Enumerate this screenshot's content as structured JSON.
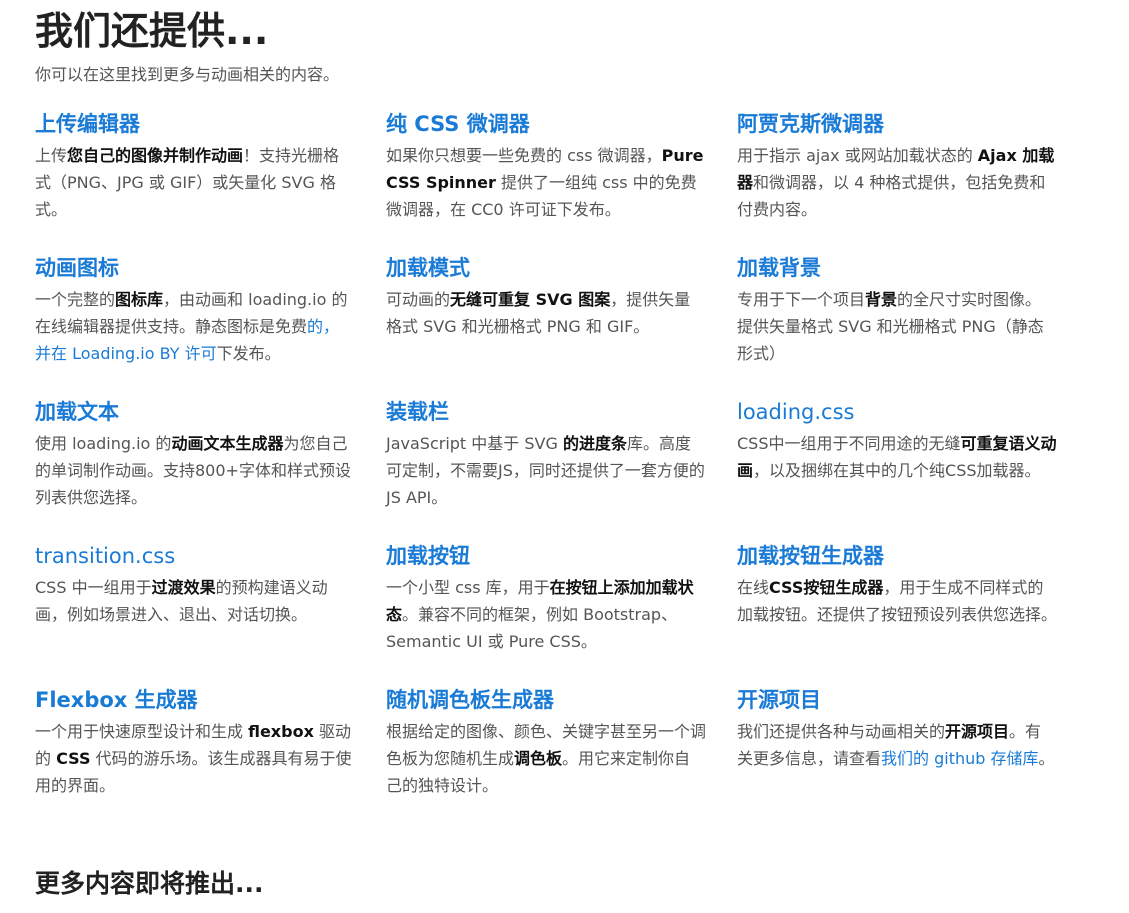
{
  "page": {
    "title": "我们还提供...",
    "subtitle": "你可以在这里找到更多与动画相关的内容。",
    "footer_heading": "更多内容即将推出..."
  },
  "colors": {
    "link": "#1a7bd6",
    "heading": "#222222",
    "text": "#555555",
    "emphasis": "#111111"
  },
  "cards": [
    {
      "title": "上传编辑器",
      "t0": "上传",
      "b0": "您自己的图像并制作动画",
      "t1": "！支持光栅格式（PNG、JPG 或 GIF）或矢量化 SVG 格式。"
    },
    {
      "title": "纯 CSS 微调器",
      "t0": "如果你只想要一些免费的 css 微调器，",
      "b0": "Pure CSS Spinner",
      "t1": " 提供了一组纯 css 中的免费微调器，在 CC0 许可证下发布。"
    },
    {
      "title": "阿贾克斯微调器",
      "t0": "用于指示 ajax 或网站加载状态的 ",
      "b0": "Ajax 加载器",
      "t1": "和微调器，以 4 种格式提供，包括免费和付费内容。"
    },
    {
      "title": "动画图标",
      "t0": "一个完整的",
      "b0": "图标库",
      "t1": "，由动画和 loading.io 的在线编辑器提供支持。静态图标是免费",
      "link": "的，并在 Loading.io BY 许可",
      "t2": "下发布。"
    },
    {
      "title": "加载模式",
      "t0": "可动画的",
      "b0": "无缝可重复 SVG 图案",
      "t1": "，提供矢量格式 SVG 和光栅格式 PNG 和 GIF。"
    },
    {
      "title": "加载背景",
      "t0": "专用于下一个项目",
      "b0": "背景",
      "t1": "的全尺寸实时图像。提供矢量格式 SVG 和光栅格式 PNG（静态形式）"
    },
    {
      "title": "加载文本",
      "t0": "使用 loading.io 的",
      "b0": "动画文本生成器",
      "t1": "为您自己的单词制作动画。支持800+字体和样式预设列表供您选择。"
    },
    {
      "title": "装载栏",
      "t0": "JavaScript 中基于 SVG ",
      "b0": "的进度条",
      "t1": "库。高度可定制，不需要JS，同时还提供了一套方便的JS API。"
    },
    {
      "title": "loading.css",
      "t0": "CSS中一组用于不同用途的无缝",
      "b0": "可重复语义动画",
      "t1": "，以及捆绑在其中的几个纯CSS加载器。"
    },
    {
      "title": "transition.css",
      "t0": "CSS 中一组用于",
      "b0": "过渡效果",
      "t1": "的预构建语义动画，例如场景进入、退出、对话切换。"
    },
    {
      "title": "加载按钮",
      "t0": "一个小型 css 库，用于",
      "b0": "在按钮上添加加载状态",
      "t1": "。兼容不同的框架，例如 Bootstrap、Semantic UI 或 Pure CSS。"
    },
    {
      "title": "加载按钮生成器",
      "t0": "在线",
      "b0": "CSS按钮生成器",
      "t1": "，用于生成不同样式的加载按钮。还提供了按钮预设列表供您选择。"
    },
    {
      "title": "Flexbox 生成器",
      "t0": "一个用于快速原型设计和生成 ",
      "b0": "flexbox",
      "t1": " 驱动的 ",
      "b1": "CSS",
      "t2": " 代码的游乐场。该生成器具有易于使用的界面。"
    },
    {
      "title": "随机调色板生成器",
      "t0": "根据给定的图像、颜色、关键字甚至另一个调色板为您随机生成",
      "b0": "调色板",
      "t1": "。用它来定制你自己的独特设计。"
    },
    {
      "title": "开源项目",
      "t0": "我们还提供各种与动画相关的",
      "b0": "开源项目",
      "t1": "。有关更多信息，请查看",
      "link": "我们的 github 存储库",
      "t2": "。"
    }
  ]
}
